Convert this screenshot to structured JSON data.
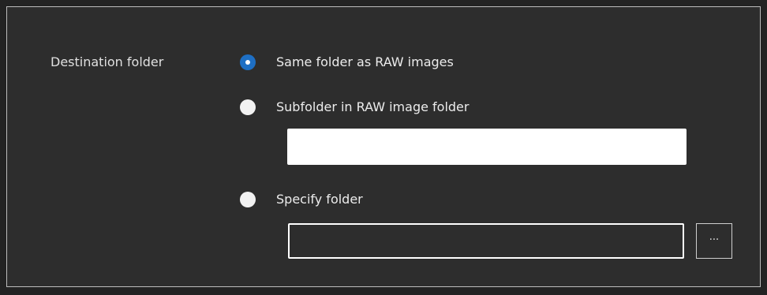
{
  "destination": {
    "section_label": "Destination folder",
    "options": [
      {
        "label": "Same folder as RAW images",
        "selected": true
      },
      {
        "label": "Subfolder in RAW image folder",
        "selected": false
      },
      {
        "label": "Specify folder",
        "selected": false
      }
    ],
    "subfolder_value": "",
    "specify_folder_value": "",
    "browse_label": "..."
  },
  "colors": {
    "selected_radio": "#1e6fc4",
    "panel_background": "#2d2d2d",
    "panel_border": "#bdbdbd"
  }
}
